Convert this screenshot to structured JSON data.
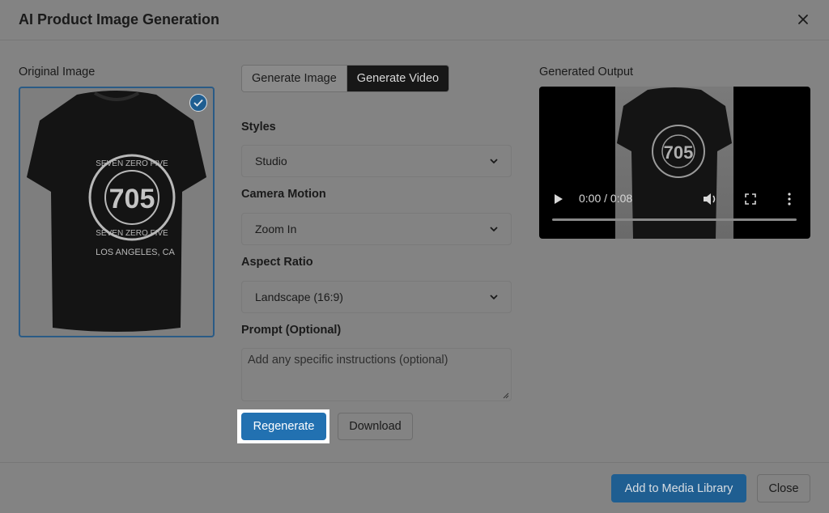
{
  "modal": {
    "title": "AI Product Image Generation"
  },
  "original": {
    "label": "Original Image",
    "shirt": {
      "line1": "SEVEN ZERO FIVE",
      "number": "705",
      "line2": "SEVEN ZERO FIVE",
      "city": "LOS ANGELES, CA"
    }
  },
  "tabs": [
    {
      "label": "Generate Image"
    },
    {
      "label": "Generate Video"
    }
  ],
  "active_tab": "Generate Video",
  "form": {
    "styles": {
      "label": "Styles",
      "value": "Studio"
    },
    "camera_motion": {
      "label": "Camera Motion",
      "value": "Zoom In"
    },
    "aspect_ratio": {
      "label": "Aspect Ratio",
      "value": "Landscape (16:9)"
    },
    "prompt": {
      "label": "Prompt (Optional)",
      "placeholder": "Add any specific instructions (optional)"
    }
  },
  "actions": {
    "regenerate": "Regenerate",
    "download": "Download"
  },
  "output": {
    "label": "Generated Output",
    "video": {
      "time": "0:00 / 0:08",
      "progress": 0
    }
  },
  "footer": {
    "add_media": "Add to Media Library",
    "close": "Close"
  },
  "colors": {
    "primary": "#2271b1",
    "overlay": "#838383",
    "dark_tab": "#171717"
  },
  "icons": {
    "close": "close-icon",
    "check": "check-icon",
    "chevron": "chevron-down-icon",
    "play": "play-icon",
    "volume": "volume-icon",
    "fullscreen": "fullscreen-icon",
    "more": "more-vertical-icon"
  }
}
